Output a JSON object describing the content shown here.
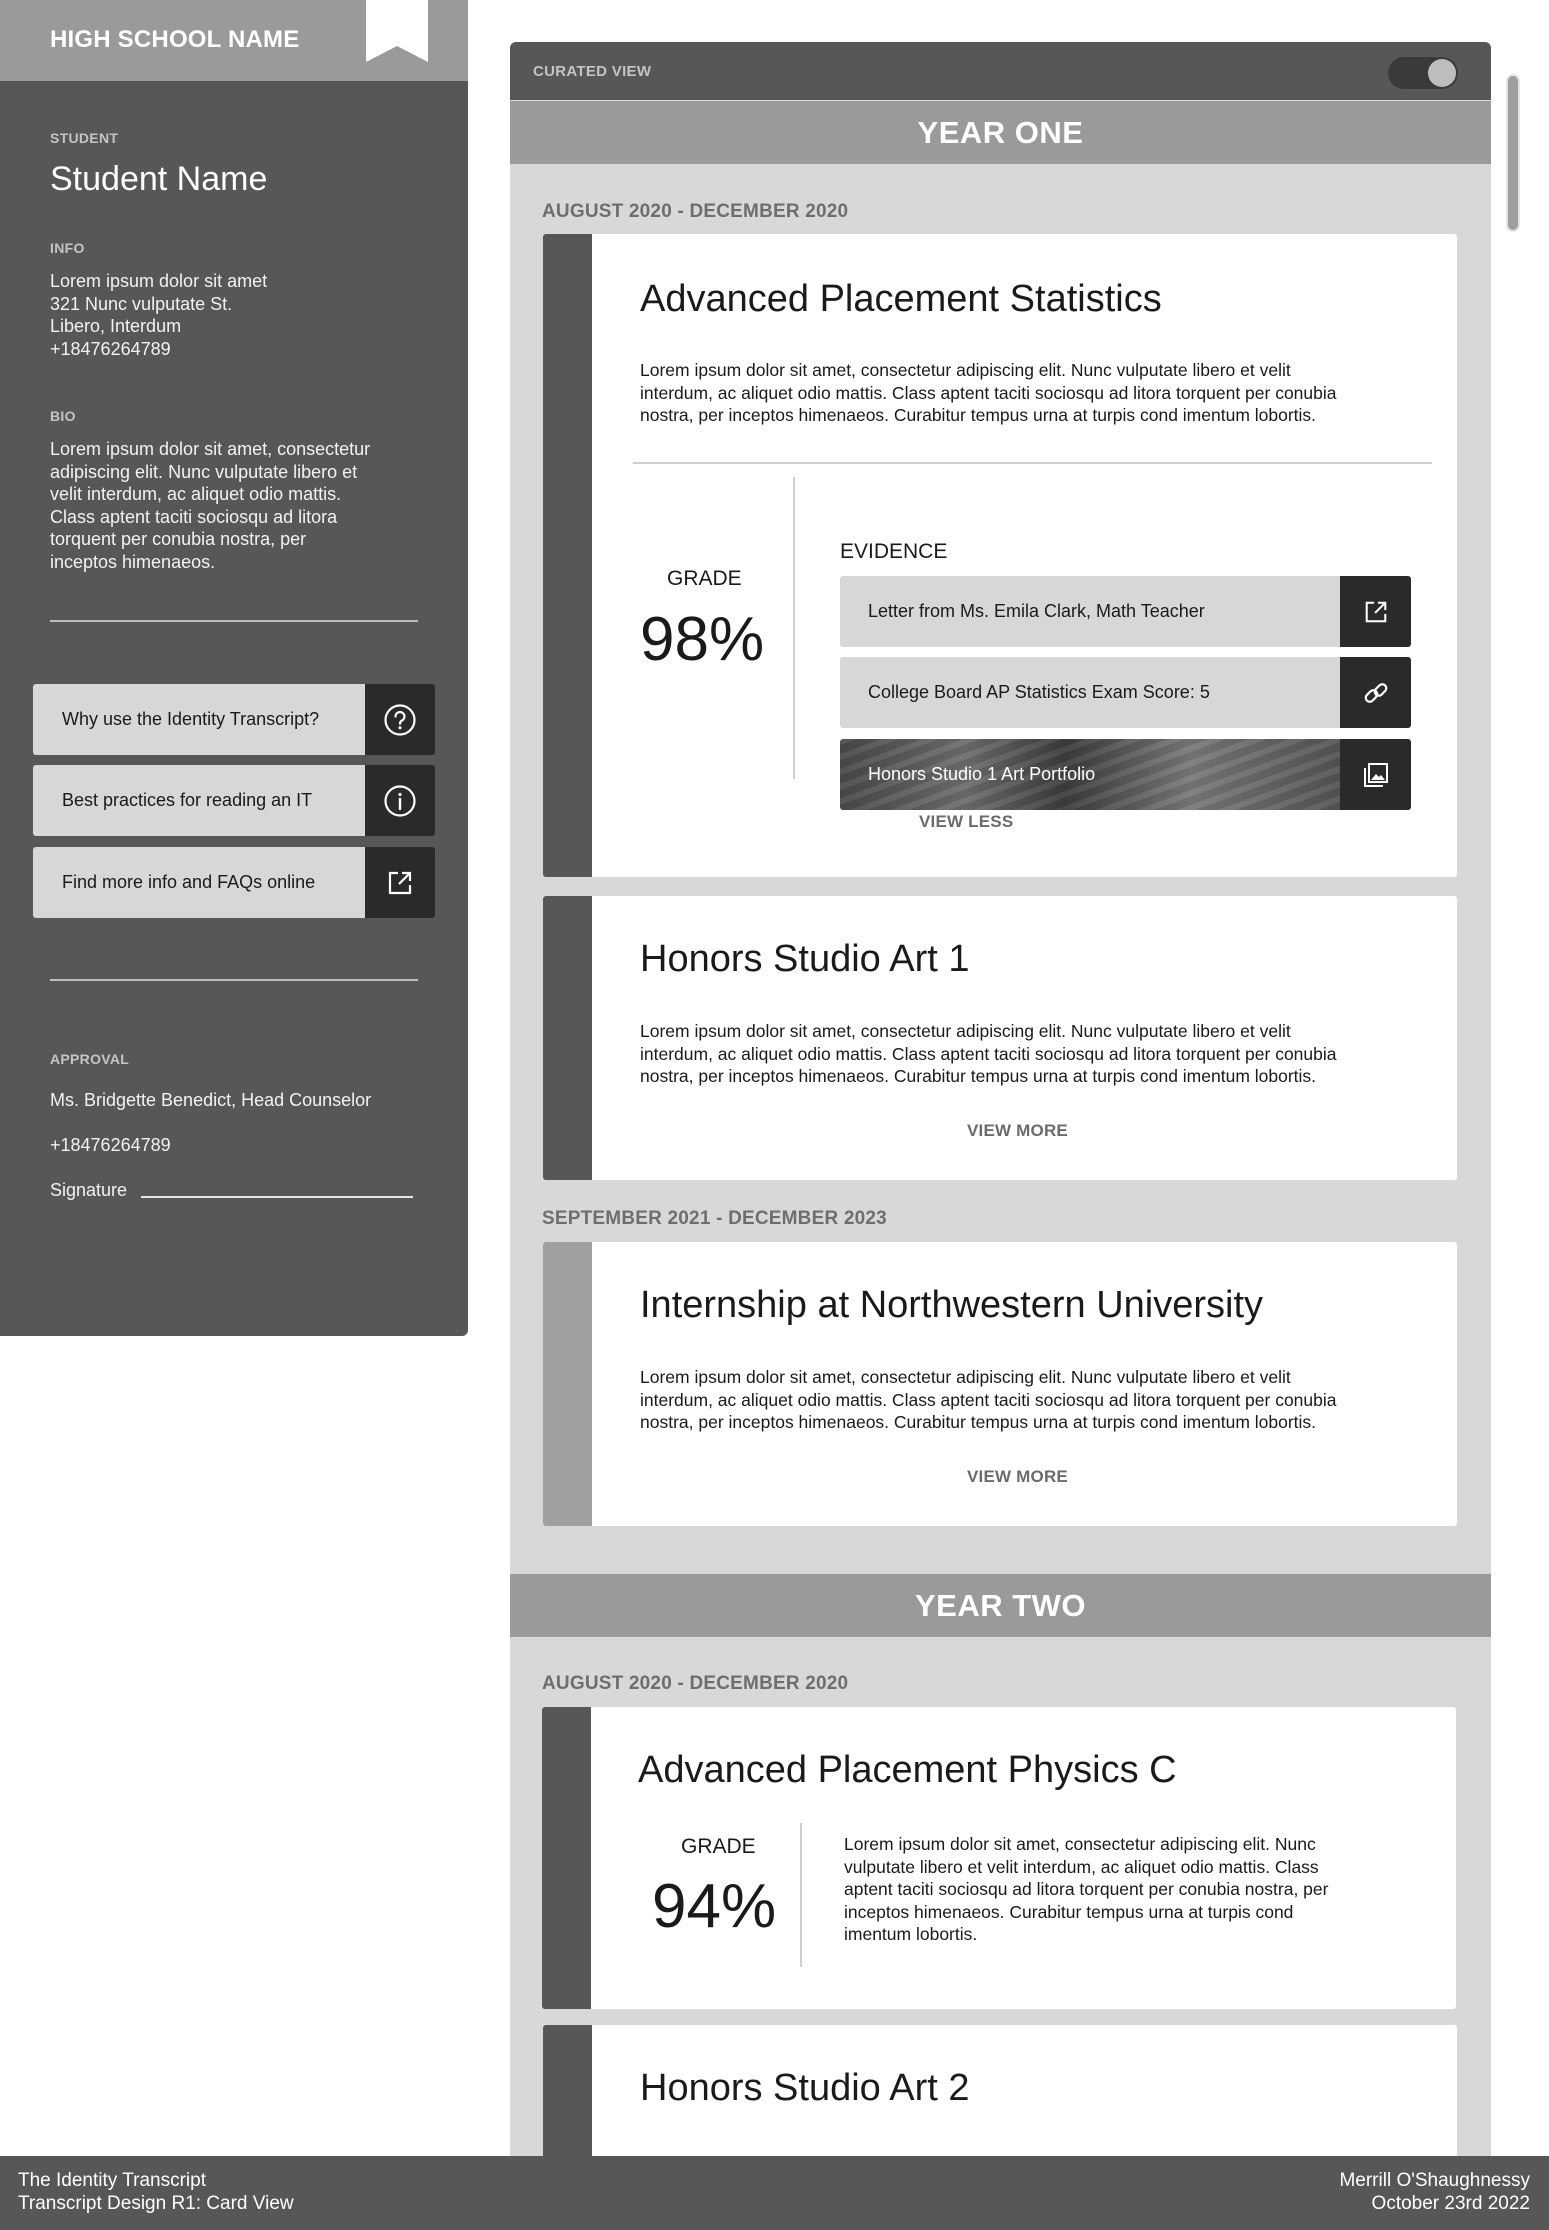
{
  "sidebar": {
    "school_name": "HIGH SCHOOL NAME",
    "student_label": "STUDENT",
    "student_name": "Student Name",
    "info_label": "INFO",
    "info_lines": [
      "Lorem ipsum dolor sit amet",
      "321 Nunc vulputate St.",
      "Libero, Interdum",
      "+18476264789"
    ],
    "bio_label": "BIO",
    "bio_lines": [
      "Lorem ipsum dolor sit amet, consectetur",
      "adipiscing elit. Nunc vulputate libero et",
      "velit interdum, ac aliquet odio mattis.",
      "Class aptent taciti sociosqu ad litora",
      "torquent per conubia nostra, per",
      "inceptos himenaeos."
    ],
    "buttons": [
      {
        "label": "Why use the Identity Transcript?",
        "icon": "question-circle-icon"
      },
      {
        "label": "Best practices for reading an IT",
        "icon": "info-circle-icon"
      },
      {
        "label": "Find more info and FAQs online",
        "icon": "external-link-icon"
      }
    ],
    "approval_label": "APPROVAL",
    "approver": "Ms. Bridgette Benedict, Head Counselor",
    "approver_phone": "+18476264789",
    "signature_label": "Signature"
  },
  "main": {
    "curated_label": "CURATED VIEW",
    "curated_toggle_on": true,
    "years": [
      {
        "label": "YEAR ONE"
      },
      {
        "label": "YEAR TWO"
      }
    ],
    "dates": [
      "AUGUST 2020 - DECEMBER 2020",
      "SEPTEMBER 2021 - DECEMBER 2023",
      "AUGUST 2020 - DECEMBER 2020"
    ],
    "cards": [
      {
        "title": "Advanced Placement Statistics",
        "desc_lines": [
          "Lorem ipsum dolor sit amet, consectetur adipiscing elit. Nunc vulputate libero et velit",
          "interdum, ac aliquet odio mattis. Class aptent taciti sociosqu ad litora torquent per conubia",
          "nostra, per inceptos himenaeos. Curabitur tempus urna at turpis cond imentum lobortis."
        ],
        "grade_label": "GRADE",
        "grade": "98%",
        "evidence_label": "EVIDENCE",
        "evidence": [
          {
            "label": "Letter from Ms. Emila Clark, Math Teacher",
            "icon": "external-link-icon"
          },
          {
            "label": "College Board AP Statistics Exam Score: 5",
            "icon": "link-icon"
          },
          {
            "label": "Honors Studio 1 Art Portfolio",
            "icon": "image-gallery-icon"
          }
        ],
        "link": "VIEW LESS"
      },
      {
        "title": "Honors Studio Art 1",
        "desc_lines": [
          "Lorem ipsum dolor sit amet, consectetur adipiscing elit. Nunc vulputate libero et velit",
          "interdum, ac aliquet odio mattis. Class aptent taciti sociosqu ad litora torquent per conubia",
          "nostra, per inceptos himenaeos. Curabitur tempus urna at turpis cond imentum lobortis."
        ],
        "link": "VIEW MORE"
      },
      {
        "title": "Internship at Northwestern University",
        "desc_lines": [
          "Lorem ipsum dolor sit amet, consectetur adipiscing elit. Nunc vulputate libero et velit",
          "interdum, ac aliquet odio mattis. Class aptent taciti sociosqu ad litora torquent per conubia",
          "nostra, per inceptos himenaeos. Curabitur tempus urna at turpis cond imentum lobortis."
        ],
        "link": "VIEW MORE"
      },
      {
        "title": "Advanced Placement Physics C",
        "grade_label": "GRADE",
        "grade": "94%",
        "desc_lines": [
          "Lorem ipsum dolor sit amet, consectetur adipiscing elit. Nunc",
          "vulputate libero et velit interdum, ac aliquet odio mattis. Class",
          "aptent taciti sociosqu ad litora torquent per conubia nostra, per",
          "inceptos himenaeos. Curabitur tempus urna at turpis cond",
          "imentum lobortis."
        ]
      },
      {
        "title": "Honors Studio Art 2"
      }
    ]
  },
  "footer": {
    "left_line1": "The Identity Transcript",
    "left_line2": "Transcript Design R1: Card View",
    "right_line1": "Merrill O'Shaughnessy",
    "right_line2": "October 23rd 2022"
  },
  "colors": {
    "sidebar_bg": "#575757",
    "header_gray": "#9a9a9a",
    "panel_bg": "#d8d8d8",
    "icon_tile": "#2a2a2a"
  }
}
